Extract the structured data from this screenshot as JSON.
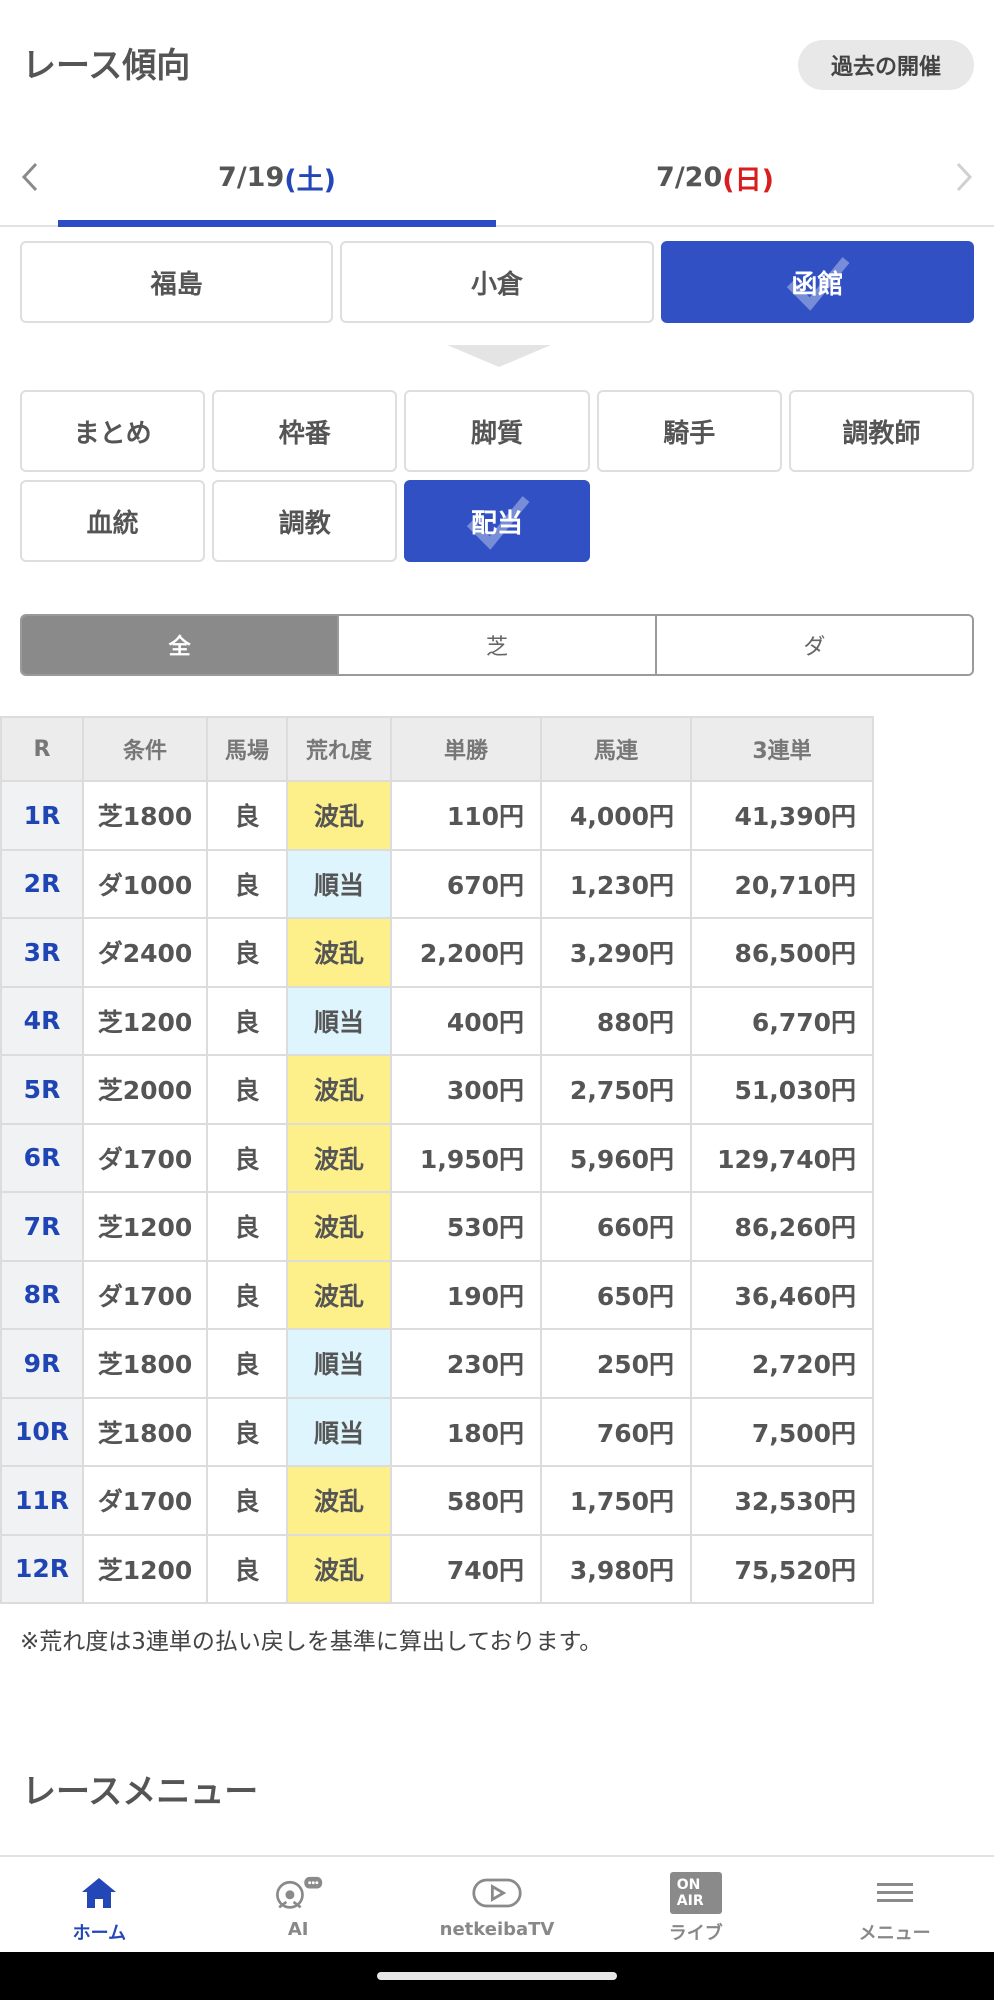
{
  "header": {
    "title": "レース傾向",
    "past_button": "過去の開催"
  },
  "dates": {
    "prev_icon": "chevron-left-icon",
    "next_icon": "chevron-right-icon",
    "tabs": [
      {
        "date": "7/19",
        "day": "(土)"
      },
      {
        "date": "7/20",
        "day": "(日)"
      }
    ]
  },
  "venues": [
    "福島",
    "小倉",
    "函館"
  ],
  "categories": [
    "まとめ",
    "枠番",
    "脚質",
    "騎手",
    "調教師",
    "血統",
    "調教",
    "配当"
  ],
  "surface": [
    "全",
    "芝",
    "ダ"
  ],
  "table": {
    "headers": [
      "R",
      "条件",
      "馬場",
      "荒れ度",
      "単勝",
      "馬連",
      "3連単"
    ],
    "rows": [
      [
        "1R",
        "芝1800",
        "良",
        "波乱",
        "110円",
        "4,000円",
        "41,390円"
      ],
      [
        "2R",
        "ダ1000",
        "良",
        "順当",
        "670円",
        "1,230円",
        "20,710円"
      ],
      [
        "3R",
        "ダ2400",
        "良",
        "波乱",
        "2,200円",
        "3,290円",
        "86,500円"
      ],
      [
        "4R",
        "芝1200",
        "良",
        "順当",
        "400円",
        "880円",
        "6,770円"
      ],
      [
        "5R",
        "芝2000",
        "良",
        "波乱",
        "300円",
        "2,750円",
        "51,030円"
      ],
      [
        "6R",
        "ダ1700",
        "良",
        "波乱",
        "1,950円",
        "5,960円",
        "129,740円"
      ],
      [
        "7R",
        "芝1200",
        "良",
        "波乱",
        "530円",
        "660円",
        "86,260円"
      ],
      [
        "8R",
        "ダ1700",
        "良",
        "波乱",
        "190円",
        "650円",
        "36,460円"
      ],
      [
        "9R",
        "芝1800",
        "良",
        "順当",
        "230円",
        "250円",
        "2,720円"
      ],
      [
        "10R",
        "芝1800",
        "良",
        "順当",
        "180円",
        "760円",
        "7,500円"
      ],
      [
        "11R",
        "ダ1700",
        "良",
        "波乱",
        "580円",
        "1,750円",
        "32,530円"
      ],
      [
        "12R",
        "芝1200",
        "良",
        "波乱",
        "740円",
        "3,980円",
        "75,520円"
      ]
    ]
  },
  "footnote": "※荒れ度は3連単の払い戻しを基準に算出しております。",
  "section_title": "レースメニュー",
  "bottom_nav": [
    {
      "label": "ホーム",
      "icon": "home-icon"
    },
    {
      "label": "AI",
      "icon": "ai-brain-icon"
    },
    {
      "label": "netkeibaTV",
      "icon": "tv-play-icon"
    },
    {
      "label": "ライブ",
      "icon": "on-air-icon",
      "badge": "ON AIR"
    },
    {
      "label": "メニュー",
      "icon": "hamburger-menu-icon"
    }
  ],
  "colors": {
    "accent": "#3050c4",
    "wild": "#fdf08a",
    "normal": "#def5fd"
  }
}
